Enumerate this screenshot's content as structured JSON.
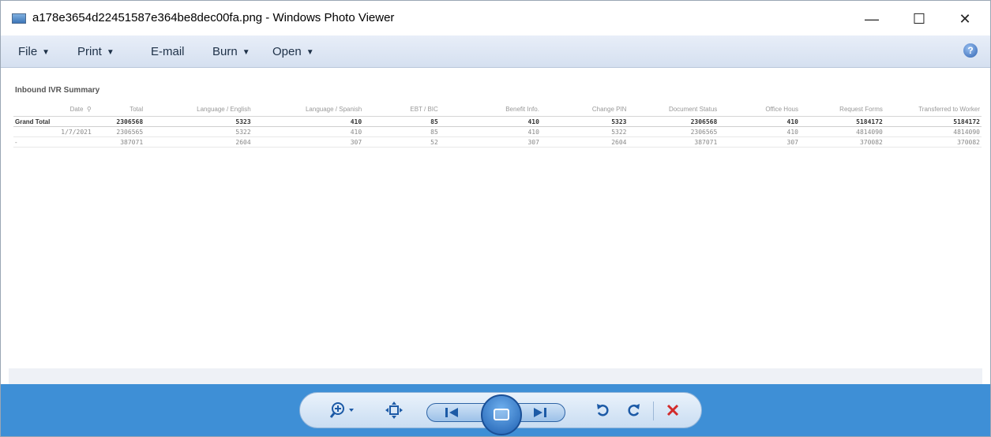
{
  "window": {
    "title": "a178e3654d22451587e364be8dec00fa.png - Windows Photo Viewer",
    "controls": {
      "minimize": "—",
      "maximize": "☐",
      "close": "✕"
    }
  },
  "menu": {
    "items": [
      {
        "label": "File",
        "dropdown": true
      },
      {
        "label": "Print",
        "dropdown": true
      },
      {
        "label": "E-mail",
        "dropdown": false
      },
      {
        "label": "Burn",
        "dropdown": true
      },
      {
        "label": "Open",
        "dropdown": true
      }
    ],
    "help": "?"
  },
  "image": {
    "title": "Inbound IVR Summary",
    "columns": [
      "Date",
      "Total",
      "Language / English",
      "Language / Spanish",
      "EBT / BIC",
      "Benefit Info.",
      "Change PIN",
      "Document Status",
      "Office Hous",
      "Request Forms",
      "Transferred to Worker"
    ],
    "rows": [
      {
        "label": "Grand Total",
        "values": [
          "2306568",
          "5323",
          "410",
          "85",
          "410",
          "5323",
          "2306568",
          "410",
          "5184172",
          "5184172"
        ]
      },
      {
        "label": "1/7/2021",
        "values": [
          "2306565",
          "5322",
          "410",
          "85",
          "410",
          "5322",
          "2306565",
          "410",
          "4814090",
          "4814090"
        ]
      },
      {
        "label": "-",
        "values": [
          "387071",
          "2604",
          "307",
          "52",
          "307",
          "2604",
          "387071",
          "307",
          "370082",
          "370082"
        ]
      }
    ]
  },
  "toolbar": {
    "icons": [
      "zoom-icon",
      "actual-size-icon",
      "previous-icon",
      "slideshow-icon",
      "next-icon",
      "rotate-counterclockwise-icon",
      "rotate-clockwise-icon",
      "delete-icon"
    ],
    "colors": {
      "bar": "#3e8fd6",
      "accent": "#1c5aa6",
      "delete": "#d22b2b"
    }
  }
}
